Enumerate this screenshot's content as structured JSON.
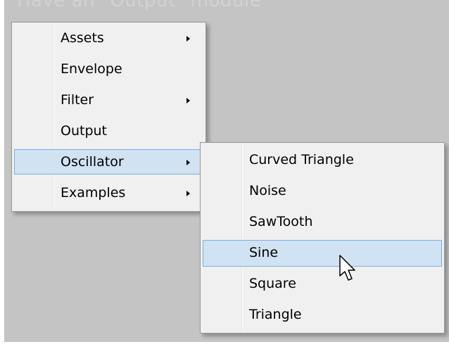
{
  "background_text": "Have an \"Output\" module",
  "main_menu": {
    "items": [
      {
        "label": "Assets",
        "has_submenu": true
      },
      {
        "label": "Envelope",
        "has_submenu": false
      },
      {
        "label": "Filter",
        "has_submenu": true
      },
      {
        "label": "Output",
        "has_submenu": false
      },
      {
        "label": "Oscillator",
        "has_submenu": true,
        "highlighted": true
      },
      {
        "label": "Examples",
        "has_submenu": true
      }
    ]
  },
  "oscillator_submenu": {
    "items": [
      {
        "label": "Curved Triangle"
      },
      {
        "label": "Noise"
      },
      {
        "label": "SawTooth"
      },
      {
        "label": "Sine",
        "highlighted": true
      },
      {
        "label": "Square"
      },
      {
        "label": "Triangle"
      }
    ]
  },
  "colors": {
    "background": "#c4c4c4",
    "menu": "#f0f0f0",
    "highlight_fill": "#d1e2f2",
    "highlight_border": "#78aee5"
  },
  "icons": {
    "submenu_arrow": "submenu-arrow-icon",
    "cursor": "mouse-pointer-icon"
  }
}
